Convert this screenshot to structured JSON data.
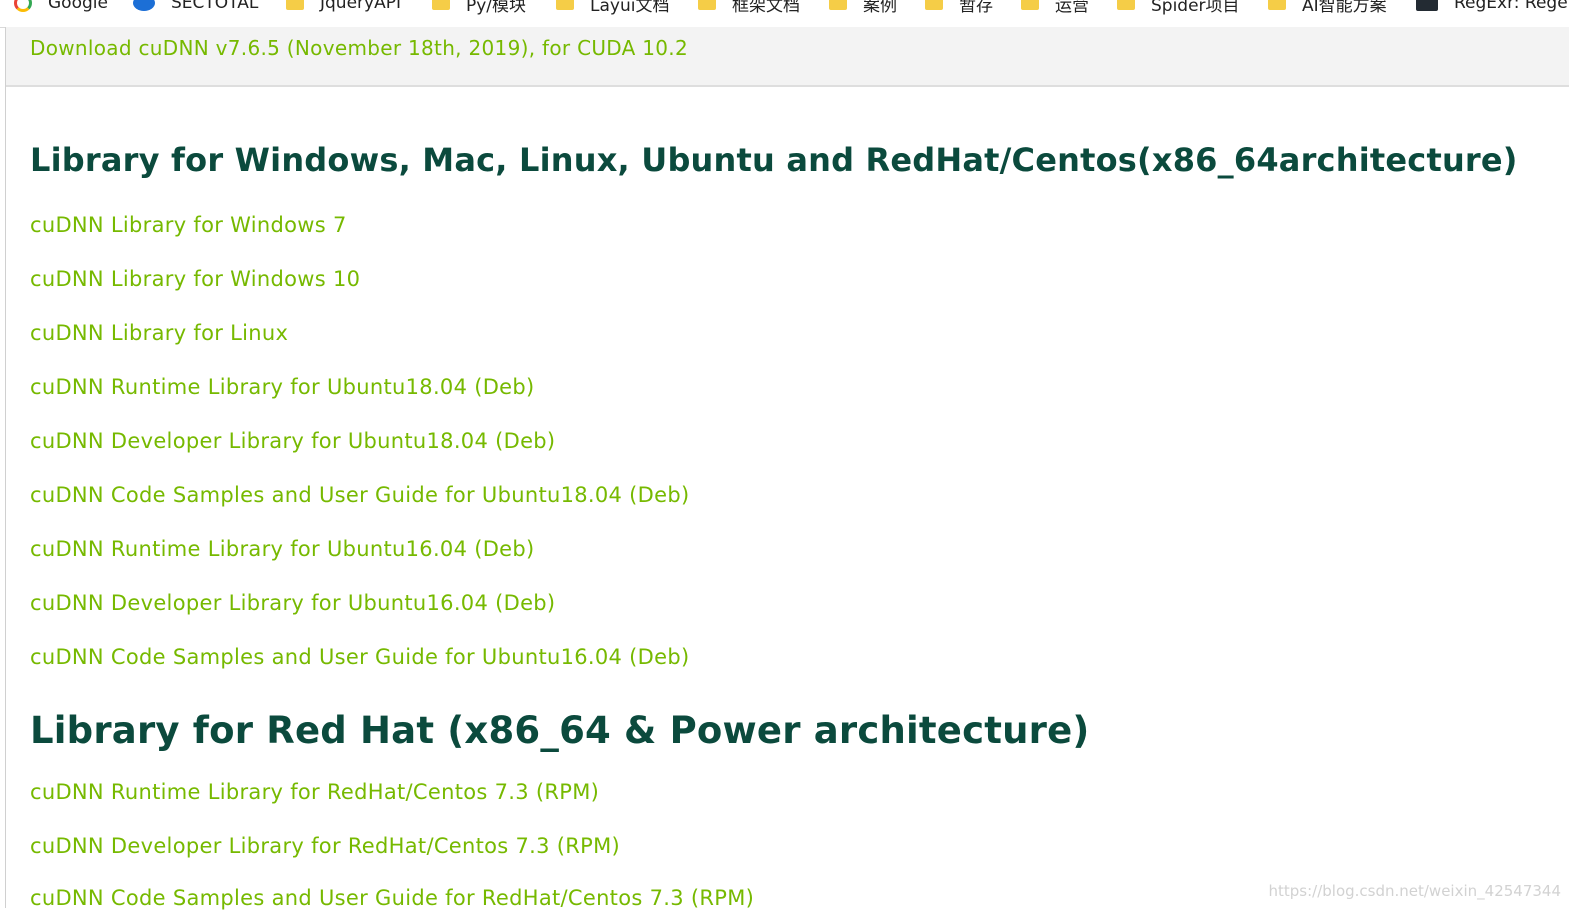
{
  "bookmarks": [
    {
      "label": "Google",
      "icon": "google-icon"
    },
    {
      "label": "SECTOTAL",
      "icon": "sectotal-icon"
    },
    {
      "label": "JqueryAPI",
      "icon": "folder-icon"
    },
    {
      "label": "Py/模块",
      "icon": "folder-icon"
    },
    {
      "label": "Layui文档",
      "icon": "folder-icon"
    },
    {
      "label": "框架文档",
      "icon": "folder-icon"
    },
    {
      "label": "案例",
      "icon": "folder-icon"
    },
    {
      "label": "暂存",
      "icon": "folder-icon"
    },
    {
      "label": "运营",
      "icon": "folder-icon"
    },
    {
      "label": "Spider项目",
      "icon": "folder-icon"
    },
    {
      "label": "AI智能方案",
      "icon": "folder-icon"
    },
    {
      "label": "RegExr: Rege",
      "icon": "regexr-icon"
    }
  ],
  "download_header": "Download cuDNN v7.6.5 (November 18th, 2019), for CUDA 10.2",
  "sections": [
    {
      "heading": "Library for Windows, Mac, Linux, Ubuntu and RedHat/Centos(x86_64architecture)",
      "links": [
        "cuDNN Library for Windows 7",
        "cuDNN Library for Windows 10",
        "cuDNN Library for Linux",
        "cuDNN Runtime Library for Ubuntu18.04 (Deb)",
        "cuDNN Developer Library for Ubuntu18.04 (Deb)",
        "cuDNN Code Samples and User Guide for Ubuntu18.04 (Deb)",
        "cuDNN Runtime Library for Ubuntu16.04 (Deb)",
        "cuDNN Developer Library for Ubuntu16.04 (Deb)",
        "cuDNN Code Samples and User Guide for Ubuntu16.04 (Deb)"
      ]
    },
    {
      "heading": "Library for Red Hat (x86_64 & Power architecture)",
      "links": [
        "cuDNN Runtime Library for RedHat/Centos 7.3 (RPM)",
        "cuDNN Developer Library for RedHat/Centos 7.3 (RPM)",
        "cuDNN Code Samples and User Guide for RedHat/Centos 7.3 (RPM)"
      ]
    }
  ],
  "watermark": "https://blog.csdn.net/weixin_42547344",
  "colors": {
    "link": "#76b900",
    "heading": "#0b4a3d"
  }
}
